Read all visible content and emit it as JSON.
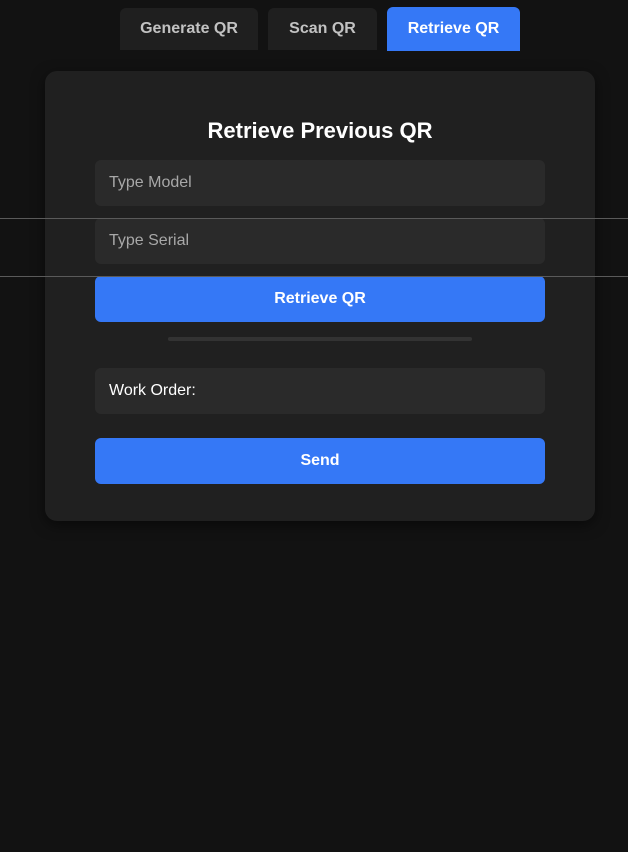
{
  "tabs": [
    {
      "label": "Generate QR",
      "active": false
    },
    {
      "label": "Scan QR",
      "active": false
    },
    {
      "label": "Retrieve QR",
      "active": true
    }
  ],
  "card": {
    "title": "Retrieve Previous QR",
    "model_placeholder": "Type Model",
    "model_value": "",
    "serial_placeholder": "Type Serial",
    "serial_value": "",
    "retrieve_button": "Retrieve QR",
    "work_order_label": "Work Order:",
    "send_button": "Send"
  },
  "colors": {
    "accent": "#3578f6",
    "background": "#121212",
    "card": "#202020",
    "field": "#2a2a2a"
  }
}
